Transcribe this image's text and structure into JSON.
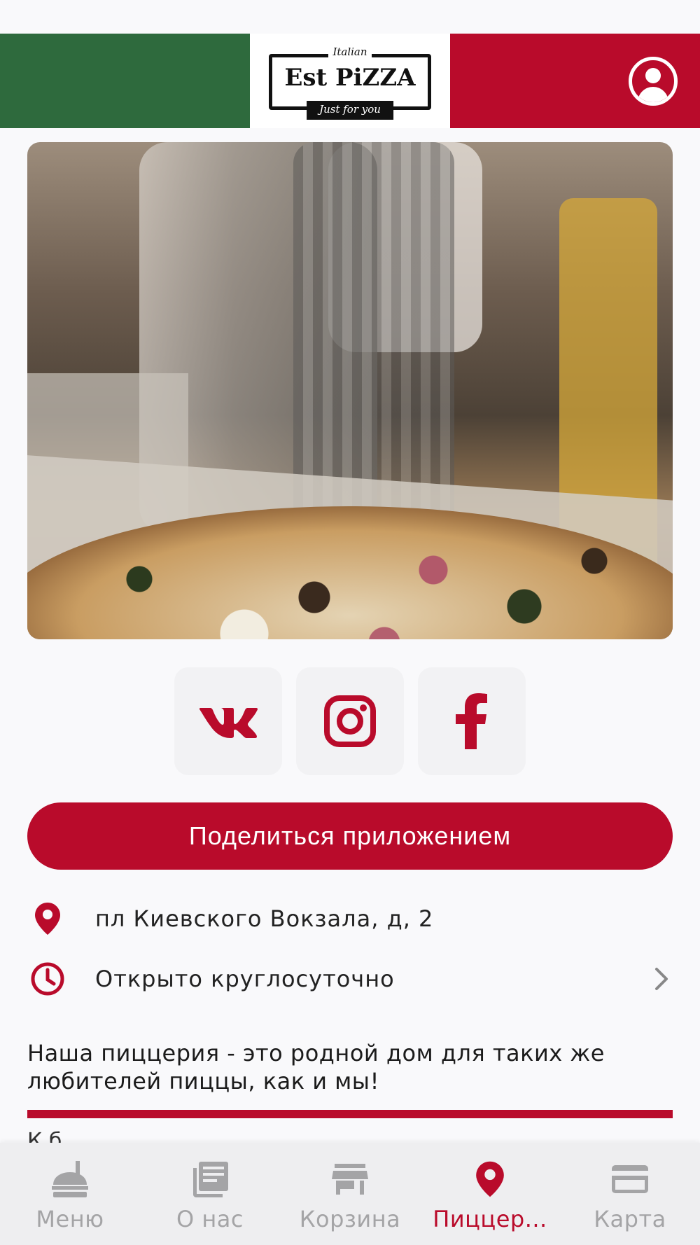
{
  "colors": {
    "flag_green": "#2e6a3d",
    "flag_red": "#b90b2b",
    "accent": "#b90b2b",
    "nav_inactive": "#a4a4a6"
  },
  "header": {
    "logo": {
      "top_text": "Italian",
      "main_text": "Est PiZZA",
      "bottom_text": "Just for you"
    },
    "profile_icon": "user-circle-icon"
  },
  "socials": [
    {
      "name": "vk",
      "icon": "vk-icon"
    },
    {
      "name": "instagram",
      "icon": "instagram-icon"
    },
    {
      "name": "facebook",
      "icon": "facebook-icon"
    }
  ],
  "share_button": {
    "label": "Поделиться приложением"
  },
  "info": {
    "address": "пл Киевского Вокзала, д, 2",
    "hours": "Открыто круглосуточно"
  },
  "about": {
    "title": "Наша пиццерия - это  родной дом для таких же любителей пиццы, как и мы!",
    "body_partial": "К                                      б"
  },
  "bottom_nav": {
    "items": [
      {
        "label": "Меню",
        "icon": "menu-food-icon",
        "active": false
      },
      {
        "label": "О нас",
        "icon": "news-icon",
        "active": false
      },
      {
        "label": "Корзина",
        "icon": "store-icon",
        "active": false
      },
      {
        "label": "Пиццер...",
        "icon": "location-pin-icon",
        "active": true
      },
      {
        "label": "Карта",
        "icon": "credit-card-icon",
        "active": false
      }
    ]
  }
}
